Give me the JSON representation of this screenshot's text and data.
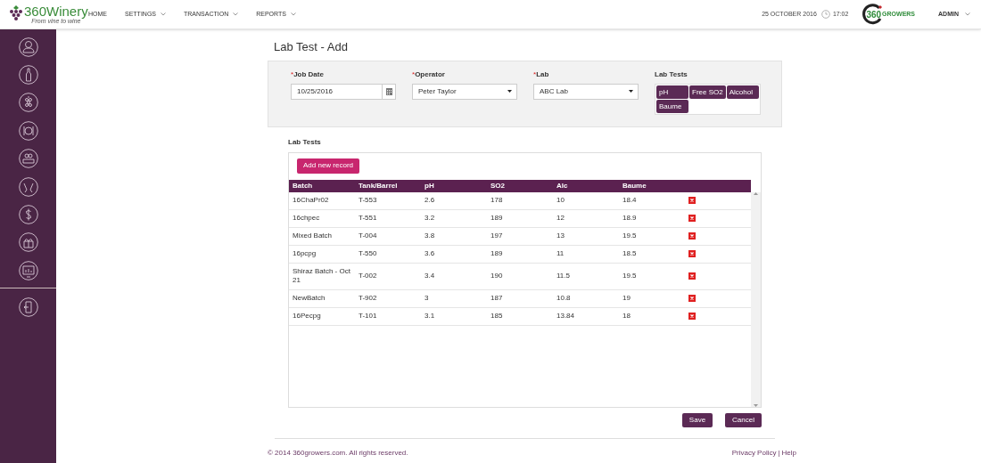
{
  "header": {
    "logo": {
      "name": "360Winery",
      "tagline": "From vine to wine"
    },
    "nav": [
      {
        "label": "HOME",
        "dropdown": false
      },
      {
        "label": "SETTINGS",
        "dropdown": true
      },
      {
        "label": "TRANSACTION",
        "dropdown": true
      },
      {
        "label": "REPORTS",
        "dropdown": true
      }
    ],
    "date": "25 OCTOBER 2016",
    "time": "17:02",
    "brand": {
      "number": "360",
      "word": "GROWERS"
    },
    "user": "ADMIN"
  },
  "sidebar": {
    "items": [
      {
        "separated": false
      },
      {
        "separated": false
      },
      {
        "separated": false
      },
      {
        "separated": false
      },
      {
        "separated": false
      },
      {
        "separated": false
      },
      {
        "separated": false
      },
      {
        "separated": false
      },
      {
        "separated": false
      },
      {
        "separated": true
      }
    ]
  },
  "page_title": "Lab Test - Add",
  "form": {
    "fields": [
      {
        "kind": "date",
        "required_mark": "*",
        "label": "Job Date",
        "value": "10/25/2016"
      },
      {
        "kind": "select",
        "required_mark": "*",
        "label": "Operator",
        "value": "Peter Taylor"
      },
      {
        "kind": "select",
        "required_mark": "*",
        "label": "Lab",
        "value": "ABC Lab"
      },
      {
        "kind": "tags",
        "label": "Lab Tests",
        "tags": [
          "pH",
          "Free SO2",
          "Alcohol",
          "Baume"
        ]
      }
    ]
  },
  "section_title": "Lab Tests",
  "add_button": "Add new record",
  "table": {
    "columns": [
      "Batch",
      "Tank/Barrel",
      "pH",
      "SO2",
      "Alc",
      "Baume"
    ],
    "rows": [
      [
        "16ChaPr02",
        "T-553",
        "2.6",
        "178",
        "10",
        "18.4"
      ],
      [
        "16chpec",
        "T-551",
        "3.2",
        "189",
        "12",
        "18.9"
      ],
      [
        "Mixed Batch",
        "T-004",
        "3.8",
        "197",
        "13",
        "19.5"
      ],
      [
        "16pcpg",
        "T-550",
        "3.6",
        "189",
        "11",
        "18.5"
      ],
      [
        "Shiraz Batch - Oct 21",
        "T-002",
        "3.4",
        "190",
        "11.5",
        "19.5"
      ],
      [
        "NewBatch",
        "T-902",
        "3",
        "187",
        "10.8",
        "19"
      ],
      [
        "16Pecpg",
        "T-101",
        "3.1",
        "185",
        "13.84",
        "18"
      ]
    ]
  },
  "buttons": [
    "Save",
    "Cancel"
  ],
  "footer": {
    "copyright": "© 2014 360growers.com. All rights reserved.",
    "links": [
      "Privacy Policy",
      "Help"
    ],
    "separator": "|"
  }
}
